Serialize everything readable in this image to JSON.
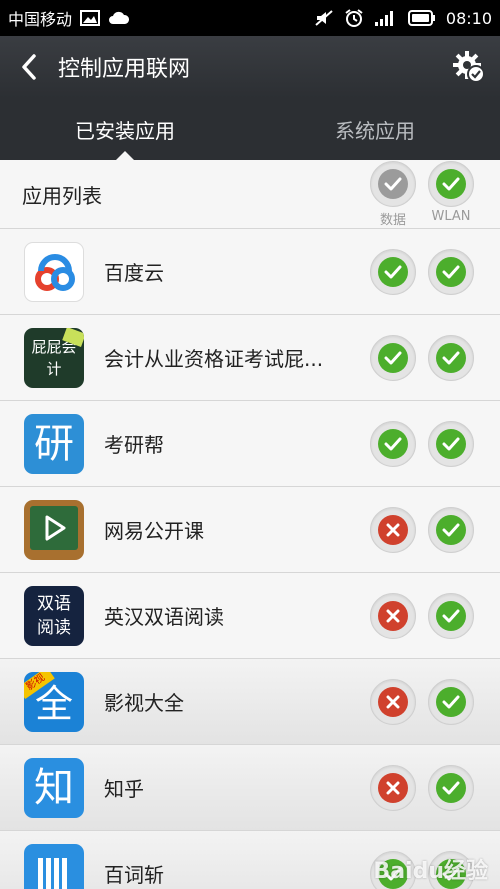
{
  "status_bar": {
    "carrier": "中国移动",
    "time": "08:10"
  },
  "header": {
    "title": "控制应用联网"
  },
  "tabs": [
    {
      "label": "已安装应用",
      "active": true
    },
    {
      "label": "系统应用",
      "active": false
    }
  ],
  "list_header": {
    "label": "应用列表",
    "col_data": "数据",
    "col_wlan": "WLAN"
  },
  "apps": [
    {
      "name": "百度云",
      "data": "allowed",
      "wlan": "allowed"
    },
    {
      "name": "会计从业资格证考试屁...",
      "data": "allowed",
      "wlan": "allowed"
    },
    {
      "name": "考研帮",
      "data": "allowed",
      "wlan": "allowed"
    },
    {
      "name": "网易公开课",
      "data": "blocked",
      "wlan": "allowed"
    },
    {
      "name": "英汉双语阅读",
      "data": "blocked",
      "wlan": "allowed"
    },
    {
      "name": "影视大全",
      "data": "blocked",
      "wlan": "allowed"
    },
    {
      "name": "知乎",
      "data": "blocked",
      "wlan": "allowed"
    },
    {
      "name": "百词斩",
      "data": "allowed",
      "wlan": "allowed"
    }
  ],
  "icon_texts": {
    "kaoyan": "研",
    "yingshi": "全",
    "yingshi_badge": "影视",
    "zhihu": "知",
    "shuangyu": "双语阅读",
    "kuaiji": "屁屁会计"
  },
  "watermark": "Baidu经验",
  "colors": {
    "allowed": "#4cae2c",
    "blocked": "#d0412d",
    "titlebar": "#2c2f33"
  }
}
